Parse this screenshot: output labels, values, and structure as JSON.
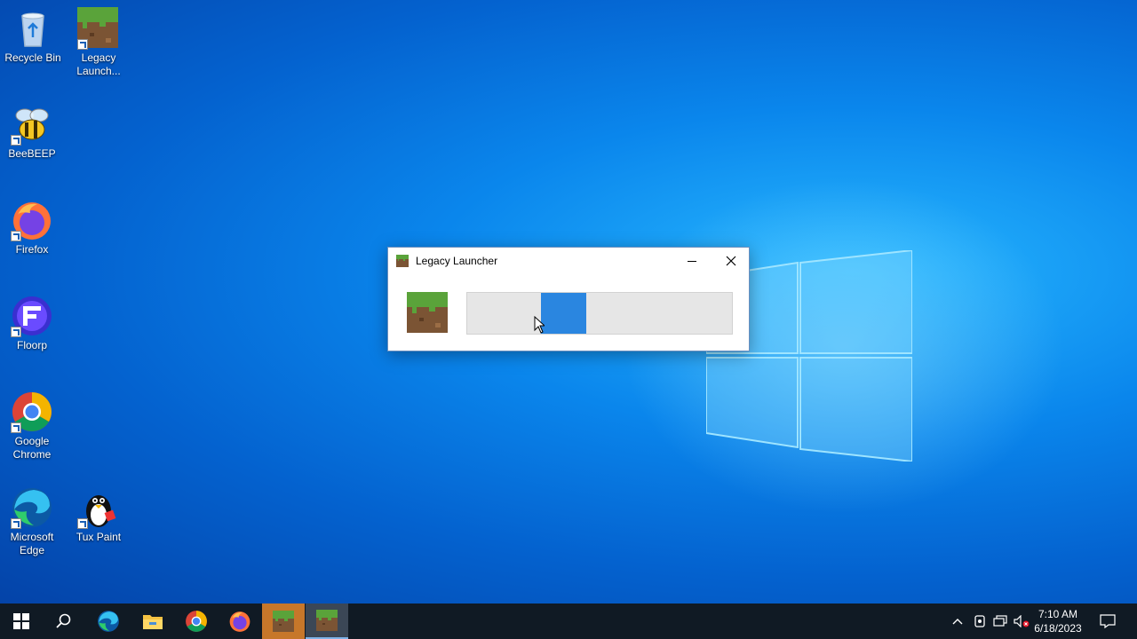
{
  "desktop": {
    "icons": [
      {
        "label": "Recycle Bin",
        "icon": "recycle-bin-icon"
      },
      {
        "label": "Legacy Launch...",
        "icon": "grass-block-icon"
      },
      {
        "label": "BeeBEEP",
        "icon": "bee-icon"
      },
      {
        "label": "Firefox",
        "icon": "firefox-icon"
      },
      {
        "label": "Floorp",
        "icon": "floorp-icon"
      },
      {
        "label": "Google Chrome",
        "icon": "chrome-icon"
      },
      {
        "label": "Microsoft Edge",
        "icon": "edge-icon"
      },
      {
        "label": "Tux Paint",
        "icon": "tux-icon"
      }
    ]
  },
  "dialog": {
    "title": "Legacy Launcher",
    "progress": {
      "type": "indeterminate",
      "segment_start": 0.28,
      "segment_end": 0.45
    }
  },
  "taskbar": {
    "apps": [
      "start-icon",
      "search-icon",
      "edge-icon",
      "file-explorer-icon",
      "chrome-icon",
      "firefox-icon",
      "grass-block-icon",
      "grass-block-icon"
    ],
    "clock": {
      "time": "7:10 AM",
      "date": "6/18/2023"
    }
  },
  "colors": {
    "accent": "#2a86e0",
    "taskbar": "#101a24",
    "active_orange": "#c7772a"
  }
}
